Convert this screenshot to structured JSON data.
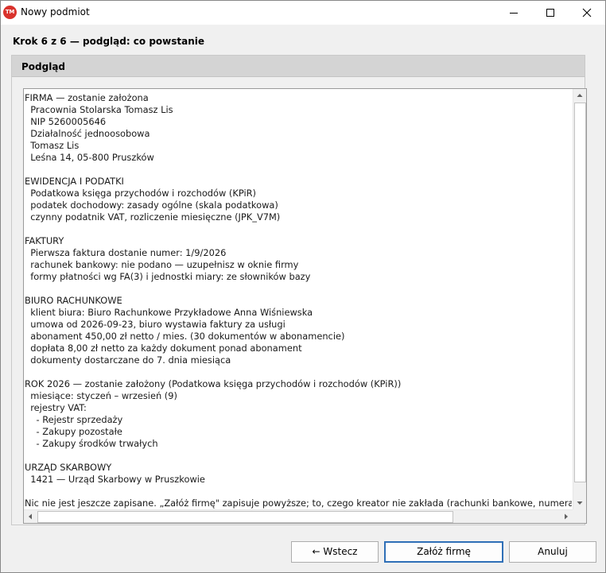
{
  "window": {
    "title": "Nowy podmiot",
    "icon_text": "TM",
    "icons": {
      "app": "app-logo-icon",
      "minimize": "minimize-icon",
      "maximize": "maximize-icon",
      "close": "close-icon"
    }
  },
  "step_heading": "Krok 6 z 6 — podgląd: co powstanie",
  "preview": {
    "title": "Podgląd",
    "lines": [
      "FIRMA — zostanie założona",
      "  Pracownia Stolarska Tomasz Lis",
      "  NIP 5260005646",
      "  Działalność jednoosobowa",
      "  Tomasz Lis",
      "  Leśna 14, 05-800 Pruszków",
      "",
      "EWIDENCJA I PODATKI",
      "  Podatkowa księga przychodów i rozchodów (KPiR)",
      "  podatek dochodowy: zasady ogólne (skala podatkowa)",
      "  czynny podatnik VAT, rozliczenie miesięczne (JPK_V7M)",
      "",
      "FAKTURY",
      "  Pierwsza faktura dostanie numer: 1/9/2026",
      "  rachunek bankowy: nie podano — uzupełnisz w oknie firmy",
      "  formy płatności wg FA(3) i jednostki miary: ze słowników bazy",
      "",
      "BIURO RACHUNKOWE",
      "  klient biura: Biuro Rachunkowe Przykładowe Anna Wiśniewska",
      "  umowa od 2026-09-23, biuro wystawia faktury za usługi",
      "  abonament 450,00 zł netto / mies. (30 dokumentów w abonamencie)",
      "  dopłata 8,00 zł netto za każdy dokument ponad abonament",
      "  dokumenty dostarczane do 7. dnia miesiąca",
      "",
      "ROK 2026 — zostanie założony (Podatkowa księga przychodów i rozchodów (KPiR))",
      "  miesiące: styczeń – wrzesień (9)",
      "  rejestry VAT:",
      "    - Rejestr sprzedaży",
      "    - Zakupy pozostałe",
      "    - Zakupy środków trwałych",
      "",
      "URZĄD SKARBOWY",
      "  1421 — Urząd Skarbowy w Pruszkowie",
      "",
      "Nic nie jest jeszcze zapisane. „Załóż firmę\" zapisuje powyższe; to, czego kreator nie zakłada (rachunki bankowe, numeracja faktur, p"
    ]
  },
  "buttons": {
    "back": "← Wstecz",
    "create": "Załóż firmę",
    "cancel": "Anuluj"
  },
  "colors": {
    "accent": "#2f6fb7",
    "icon_red": "#d9322c"
  }
}
